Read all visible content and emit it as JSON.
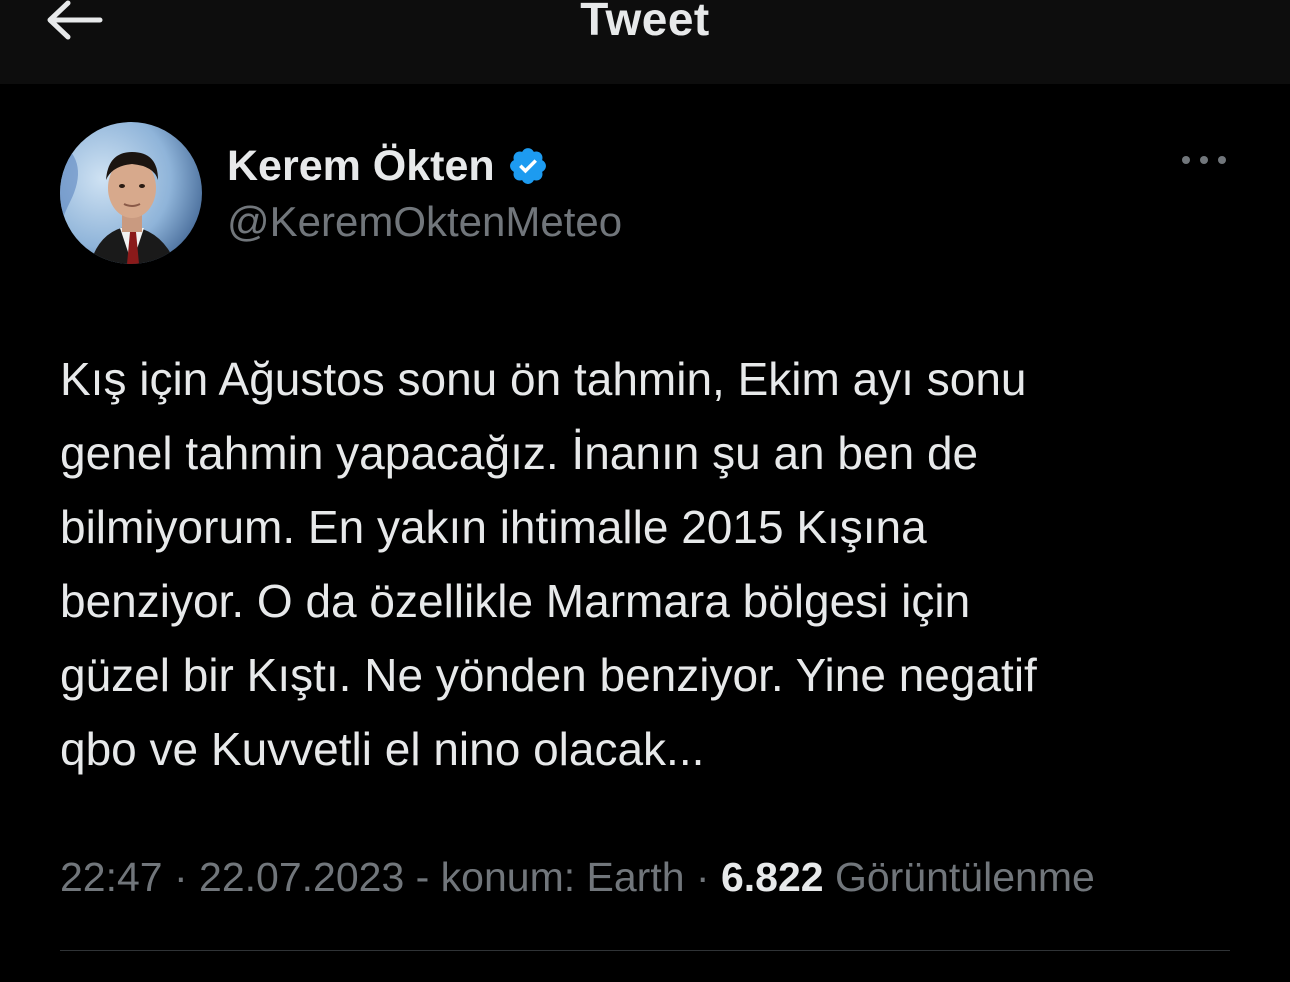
{
  "header": {
    "title": "Tweet",
    "back_icon": "arrow-left-icon"
  },
  "tweet": {
    "author": {
      "display_name": "Kerem Ökten",
      "handle": "@KeremOktenMeteo",
      "verified_icon": "verified-badge-icon",
      "verified_color": "#1d9bf0"
    },
    "more_icon": "more-horizontal-icon",
    "text": "Kış için Ağustos sonu ön tahmin, Ekim ayı sonu\ngenel tahmin yapacağız. İnanın şu an ben de\nbilmiyorum. En yakın ihtimalle 2015 Kışına\nbenziyor. O da özellikle Marmara bölgesi için\ngüzel bir Kıştı. Ne yönden benziyor. Yine negatif\nqbo ve Kuvvetli el nino olacak...",
    "time": "22:47",
    "separator1": " · ",
    "date": "22.07.2023",
    "location_label": " - konum: Earth",
    "separator2": " · ",
    "views_count": "6.822",
    "views_label": " Görüntülenme"
  },
  "colors": {
    "background": "#000000",
    "text_primary": "#e7e9ea",
    "text_secondary": "#71767b",
    "accent": "#1d9bf0"
  }
}
